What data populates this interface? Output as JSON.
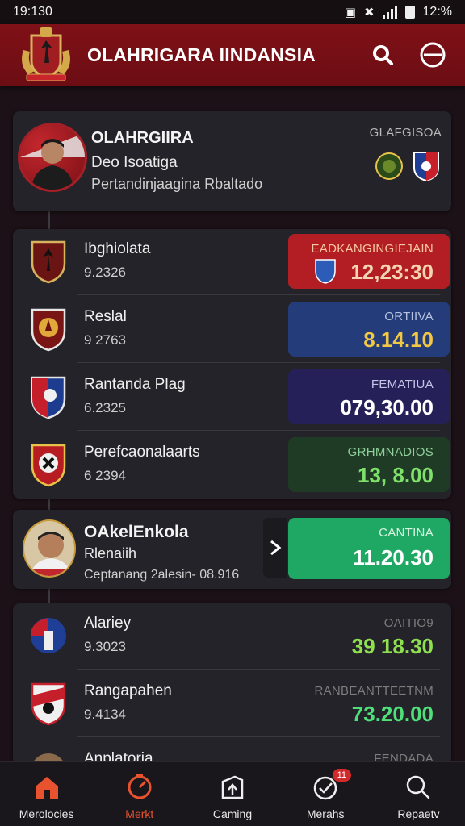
{
  "status": {
    "time": "19:130",
    "battery": "12:%"
  },
  "header": {
    "title": "OLAHRIGARA IINDANSIA"
  },
  "featured": {
    "name": "OLAHRGIIRA",
    "subtitle": "Deo Isoatiga",
    "description": "Pertandinjaagina Rbaltado",
    "side_label": "GLAFGISOA"
  },
  "matches": [
    {
      "name": "Ibghiolata",
      "sub": "9.2326",
      "odds_label": "EADKANGINGIEJAIN",
      "odds_value": "12,23:30",
      "bg": "#b21e24",
      "label_color": "#f7c8a0",
      "value_color": "#f5d4b0"
    },
    {
      "name": "Reslal",
      "sub": "9 2763",
      "odds_label": "ORTIIVA",
      "odds_value": "8.14.10",
      "bg": "#243d7a",
      "label_color": "#b6c2e0",
      "value_color": "#f2c744"
    },
    {
      "name": "Rantanda Plag",
      "sub": "6.2325",
      "odds_label": "FEMATIUA",
      "odds_value": "079,30.00",
      "bg": "#252158",
      "label_color": "#c6c4e6",
      "value_color": "#ffffff"
    },
    {
      "name": "Perefcaonalaarts",
      "sub": "6 2394",
      "odds_label": "GRHMNADIOS",
      "odds_value": "13, 8.00",
      "bg": "#1f3a25",
      "label_color": "#8fd09a",
      "value_color": "#7fe06a"
    }
  ],
  "highlight": {
    "name": "OAkelEnkola",
    "subtitle": "Rlenaiih",
    "detail": "Ceptanang 2alesin- 08.916",
    "odds_label": "CANTINA",
    "odds_value": "11.20.30"
  },
  "matches2": [
    {
      "name": "Alariey",
      "sub": "9.3023",
      "odds_label": "OAITIO9",
      "odds_value": "39 18.30"
    },
    {
      "name": "Rangapahen",
      "sub": "9.4134",
      "odds_label": "RANBEANTTEETNM",
      "odds_value": "73.20.00"
    },
    {
      "name": "Anplatoria",
      "sub": "",
      "odds_label": "FENDADA",
      "odds_value": ""
    }
  ],
  "nav": [
    {
      "label": "Merolocies",
      "icon": "home-icon"
    },
    {
      "label": "Merkt",
      "icon": "market-icon"
    },
    {
      "label": "Caming",
      "icon": "gaming-icon"
    },
    {
      "label": "Merahs",
      "icon": "matches-icon",
      "badge": "11"
    },
    {
      "label": "Repaetv",
      "icon": "search-icon"
    }
  ],
  "colors": {
    "header": "#7f1117",
    "accent_green": "#1ea864",
    "active_nav": "#e8522f"
  }
}
